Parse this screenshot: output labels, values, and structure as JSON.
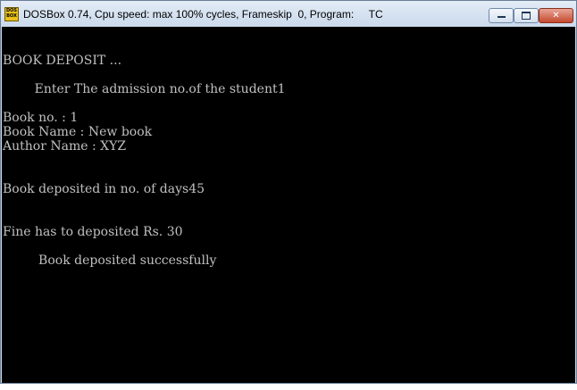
{
  "window": {
    "title": "DOSBox 0.74, Cpu speed: max 100% cycles, Frameskip  0, Program:     TC",
    "icon_label": "DOS BOX",
    "min_glyph": "minimize-icon",
    "max_glyph": "maximize-icon",
    "close_glyph": "✕"
  },
  "console": {
    "text_color": "#c0c0c0",
    "background": "#000000",
    "lines": [
      "BOOK DEPOSIT ...",
      "        Enter The admission no.of the student1",
      "Book no. : 1",
      "Book Name : New book",
      "Author Name : XYZ",
      "Book deposited in no. of days45",
      "Fine has to deposited Rs. 30",
      "         Book deposited successfully"
    ]
  }
}
